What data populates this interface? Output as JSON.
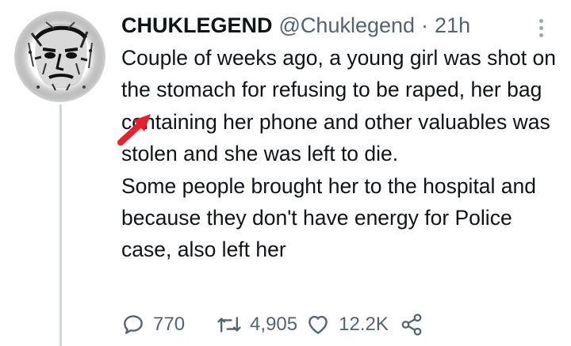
{
  "tweet": {
    "display_name": "CHUKLEGEND",
    "handle": "@Chuklegend",
    "separator": "·",
    "time": "21h",
    "avatar_icon": "sketched-face-portrait",
    "body_lines": [
      "Couple of weeks ago, a young girl was shot on the stomach for refusing to be raped, her bag containing her phone and other valuables was stolen and she was left to die.",
      "Some people brought her to the hospital and because they don't have energy for Police case, also left her"
    ],
    "actions": {
      "reply": {
        "icon": "reply-icon",
        "count": "770"
      },
      "retweet": {
        "icon": "retweet-icon",
        "count": "4,905"
      },
      "like": {
        "icon": "heart-icon",
        "count": "12.2K"
      },
      "share": {
        "icon": "share-icon"
      }
    }
  },
  "colors": {
    "text": "#0f1419",
    "secondary": "#536471",
    "thread_line": "#cfd9de",
    "arrow_annotation": "#e8202a"
  }
}
